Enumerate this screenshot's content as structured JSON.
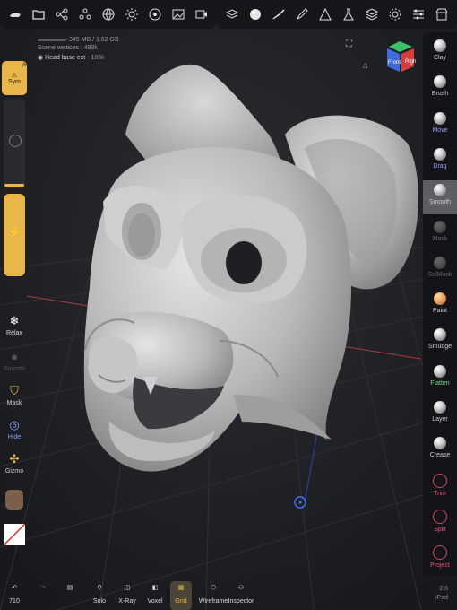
{
  "stats": {
    "memory": "345 MB / 1.62 GB",
    "vertices": "Scene vertices : 493k"
  },
  "mesh": {
    "name": "Head base ext",
    "verts": "165k"
  },
  "left_tools": {
    "sym": "Sym",
    "sym_corner": "W",
    "relax": "Relax",
    "smooth": "Smooth",
    "mask": "Mask",
    "hide": "Hide",
    "gizmo": "Gizmo"
  },
  "right_tools": [
    "Clay",
    "Brush",
    "Move",
    "Drag",
    "Smooth",
    "Mask",
    "SelMask",
    "Paint",
    "Smudge",
    "Flatten",
    "Layer",
    "Crease",
    "Trim",
    "Split",
    "Project"
  ],
  "gizmo_labels": {
    "front": "Front",
    "right": "Righ"
  },
  "bottom": {
    "undo_count": "710",
    "solo": "Solo",
    "xray": "X-Ray",
    "voxel": "Voxel",
    "grid": "Grid",
    "wireframe": "Wireframe",
    "inspector": "Inspector"
  },
  "device": {
    "version": "2.8",
    "platform": "iPad"
  },
  "colors": {
    "accent": "#e8b64b",
    "toolbar": "#16161a",
    "grid_red": "#c94040",
    "grid_blue": "#3a4fcf"
  },
  "icons": {
    "top_left": [
      "settings-icon",
      "folder-icon",
      "scene-icon",
      "topology-icon",
      "globe-icon",
      "light-icon",
      "material-icon",
      "image-icon",
      "video-icon"
    ],
    "top_right": [
      "layers-icon",
      "sphere-icon",
      "stroke-icon",
      "pen-icon",
      "triangle-icon",
      "flask-icon",
      "stack-icon",
      "gear-icon",
      "sliders-icon",
      "store-icon"
    ]
  }
}
